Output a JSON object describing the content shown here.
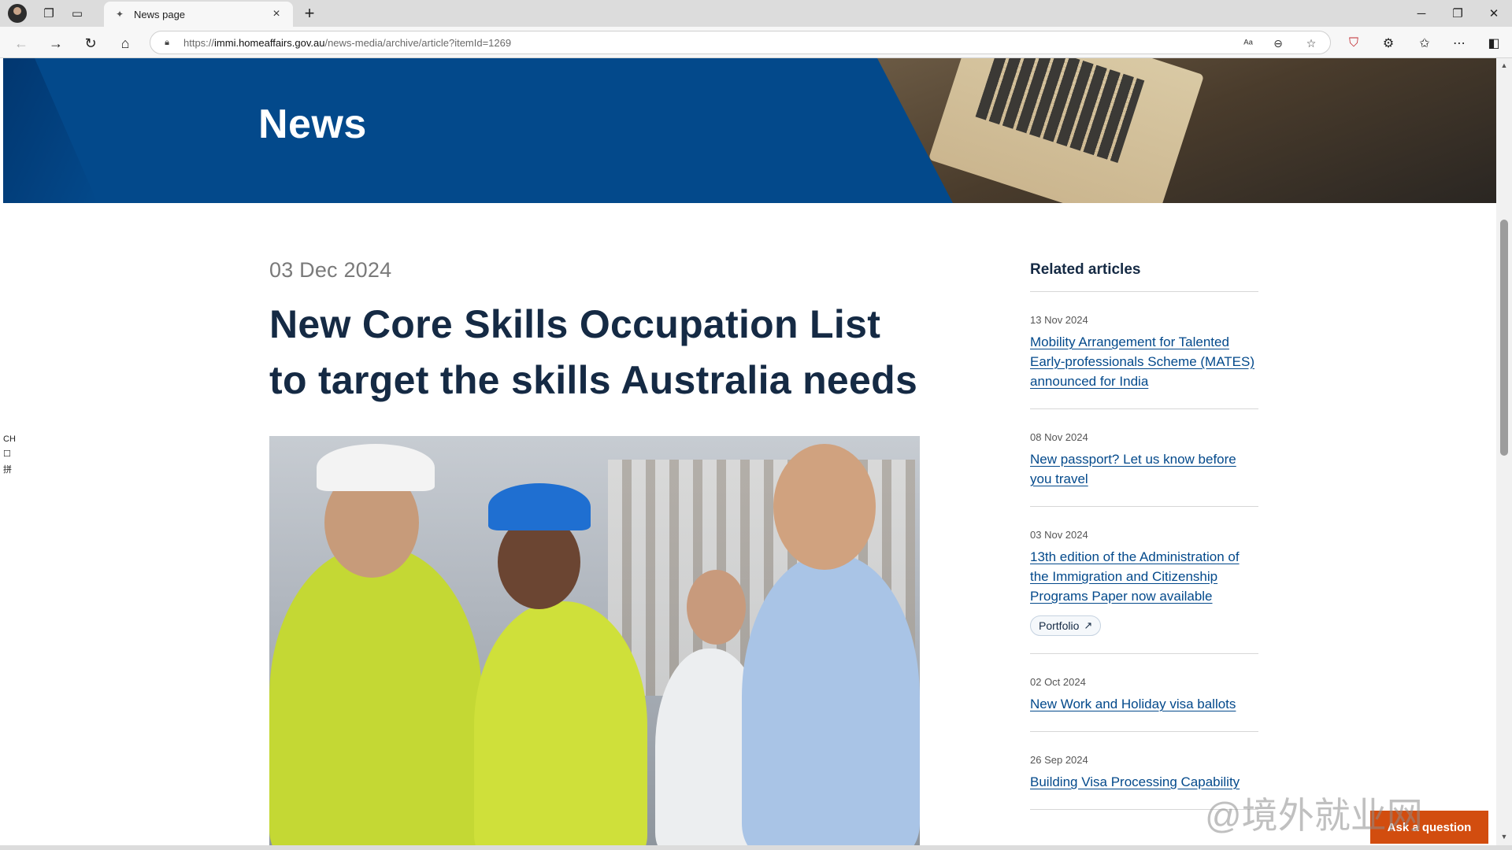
{
  "browser": {
    "tab_title": "News page",
    "url_proto": "https://",
    "url_host": "immi.homeaffairs.gov.au",
    "url_path": "/news-media/archive/article?itemId=1269"
  },
  "page": {
    "hero_title": "News",
    "article": {
      "date": "03 Dec 2024",
      "headline": "New Core Skills Occupation List to target the skills Australia needs"
    },
    "related": {
      "title": "Related articles",
      "items": [
        {
          "date": "13 Nov 2024",
          "title": "Mobility Arrangement for Talented Early-professionals Scheme (MATES) announced for India"
        },
        {
          "date": "08 Nov 2024",
          "title": "New passport? Let us know before you travel"
        },
        {
          "date": "03 Nov 2024",
          "title": "13th edition of the Administration of the Immigration and Citizenship Programs Paper now available",
          "tag": "Portfolio"
        },
        {
          "date": "02 Oct 2024",
          "title": "New Work and Holiday visa ballots"
        },
        {
          "date": "26 Sep 2024",
          "title": "Building Visa Processing Capability"
        }
      ]
    },
    "ask_button": "Ask a question",
    "left_rail": [
      "CH",
      "☐",
      "拼"
    ],
    "watermark": "@境外就业网"
  }
}
